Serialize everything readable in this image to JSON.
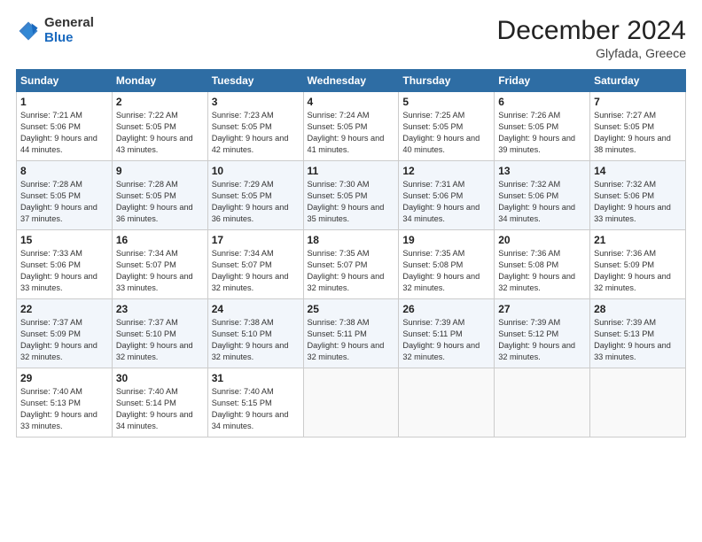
{
  "header": {
    "logo_general": "General",
    "logo_blue": "Blue",
    "month_title": "December 2024",
    "location": "Glyfada, Greece"
  },
  "weekdays": [
    "Sunday",
    "Monday",
    "Tuesday",
    "Wednesday",
    "Thursday",
    "Friday",
    "Saturday"
  ],
  "weeks": [
    [
      {
        "day": "1",
        "sunrise": "Sunrise: 7:21 AM",
        "sunset": "Sunset: 5:06 PM",
        "daylight": "Daylight: 9 hours and 44 minutes."
      },
      {
        "day": "2",
        "sunrise": "Sunrise: 7:22 AM",
        "sunset": "Sunset: 5:05 PM",
        "daylight": "Daylight: 9 hours and 43 minutes."
      },
      {
        "day": "3",
        "sunrise": "Sunrise: 7:23 AM",
        "sunset": "Sunset: 5:05 PM",
        "daylight": "Daylight: 9 hours and 42 minutes."
      },
      {
        "day": "4",
        "sunrise": "Sunrise: 7:24 AM",
        "sunset": "Sunset: 5:05 PM",
        "daylight": "Daylight: 9 hours and 41 minutes."
      },
      {
        "day": "5",
        "sunrise": "Sunrise: 7:25 AM",
        "sunset": "Sunset: 5:05 PM",
        "daylight": "Daylight: 9 hours and 40 minutes."
      },
      {
        "day": "6",
        "sunrise": "Sunrise: 7:26 AM",
        "sunset": "Sunset: 5:05 PM",
        "daylight": "Daylight: 9 hours and 39 minutes."
      },
      {
        "day": "7",
        "sunrise": "Sunrise: 7:27 AM",
        "sunset": "Sunset: 5:05 PM",
        "daylight": "Daylight: 9 hours and 38 minutes."
      }
    ],
    [
      {
        "day": "8",
        "sunrise": "Sunrise: 7:28 AM",
        "sunset": "Sunset: 5:05 PM",
        "daylight": "Daylight: 9 hours and 37 minutes."
      },
      {
        "day": "9",
        "sunrise": "Sunrise: 7:28 AM",
        "sunset": "Sunset: 5:05 PM",
        "daylight": "Daylight: 9 hours and 36 minutes."
      },
      {
        "day": "10",
        "sunrise": "Sunrise: 7:29 AM",
        "sunset": "Sunset: 5:05 PM",
        "daylight": "Daylight: 9 hours and 36 minutes."
      },
      {
        "day": "11",
        "sunrise": "Sunrise: 7:30 AM",
        "sunset": "Sunset: 5:05 PM",
        "daylight": "Daylight: 9 hours and 35 minutes."
      },
      {
        "day": "12",
        "sunrise": "Sunrise: 7:31 AM",
        "sunset": "Sunset: 5:06 PM",
        "daylight": "Daylight: 9 hours and 34 minutes."
      },
      {
        "day": "13",
        "sunrise": "Sunrise: 7:32 AM",
        "sunset": "Sunset: 5:06 PM",
        "daylight": "Daylight: 9 hours and 34 minutes."
      },
      {
        "day": "14",
        "sunrise": "Sunrise: 7:32 AM",
        "sunset": "Sunset: 5:06 PM",
        "daylight": "Daylight: 9 hours and 33 minutes."
      }
    ],
    [
      {
        "day": "15",
        "sunrise": "Sunrise: 7:33 AM",
        "sunset": "Sunset: 5:06 PM",
        "daylight": "Daylight: 9 hours and 33 minutes."
      },
      {
        "day": "16",
        "sunrise": "Sunrise: 7:34 AM",
        "sunset": "Sunset: 5:07 PM",
        "daylight": "Daylight: 9 hours and 33 minutes."
      },
      {
        "day": "17",
        "sunrise": "Sunrise: 7:34 AM",
        "sunset": "Sunset: 5:07 PM",
        "daylight": "Daylight: 9 hours and 32 minutes."
      },
      {
        "day": "18",
        "sunrise": "Sunrise: 7:35 AM",
        "sunset": "Sunset: 5:07 PM",
        "daylight": "Daylight: 9 hours and 32 minutes."
      },
      {
        "day": "19",
        "sunrise": "Sunrise: 7:35 AM",
        "sunset": "Sunset: 5:08 PM",
        "daylight": "Daylight: 9 hours and 32 minutes."
      },
      {
        "day": "20",
        "sunrise": "Sunrise: 7:36 AM",
        "sunset": "Sunset: 5:08 PM",
        "daylight": "Daylight: 9 hours and 32 minutes."
      },
      {
        "day": "21",
        "sunrise": "Sunrise: 7:36 AM",
        "sunset": "Sunset: 5:09 PM",
        "daylight": "Daylight: 9 hours and 32 minutes."
      }
    ],
    [
      {
        "day": "22",
        "sunrise": "Sunrise: 7:37 AM",
        "sunset": "Sunset: 5:09 PM",
        "daylight": "Daylight: 9 hours and 32 minutes."
      },
      {
        "day": "23",
        "sunrise": "Sunrise: 7:37 AM",
        "sunset": "Sunset: 5:10 PM",
        "daylight": "Daylight: 9 hours and 32 minutes."
      },
      {
        "day": "24",
        "sunrise": "Sunrise: 7:38 AM",
        "sunset": "Sunset: 5:10 PM",
        "daylight": "Daylight: 9 hours and 32 minutes."
      },
      {
        "day": "25",
        "sunrise": "Sunrise: 7:38 AM",
        "sunset": "Sunset: 5:11 PM",
        "daylight": "Daylight: 9 hours and 32 minutes."
      },
      {
        "day": "26",
        "sunrise": "Sunrise: 7:39 AM",
        "sunset": "Sunset: 5:11 PM",
        "daylight": "Daylight: 9 hours and 32 minutes."
      },
      {
        "day": "27",
        "sunrise": "Sunrise: 7:39 AM",
        "sunset": "Sunset: 5:12 PM",
        "daylight": "Daylight: 9 hours and 32 minutes."
      },
      {
        "day": "28",
        "sunrise": "Sunrise: 7:39 AM",
        "sunset": "Sunset: 5:13 PM",
        "daylight": "Daylight: 9 hours and 33 minutes."
      }
    ],
    [
      {
        "day": "29",
        "sunrise": "Sunrise: 7:40 AM",
        "sunset": "Sunset: 5:13 PM",
        "daylight": "Daylight: 9 hours and 33 minutes."
      },
      {
        "day": "30",
        "sunrise": "Sunrise: 7:40 AM",
        "sunset": "Sunset: 5:14 PM",
        "daylight": "Daylight: 9 hours and 34 minutes."
      },
      {
        "day": "31",
        "sunrise": "Sunrise: 7:40 AM",
        "sunset": "Sunset: 5:15 PM",
        "daylight": "Daylight: 9 hours and 34 minutes."
      },
      null,
      null,
      null,
      null
    ]
  ]
}
